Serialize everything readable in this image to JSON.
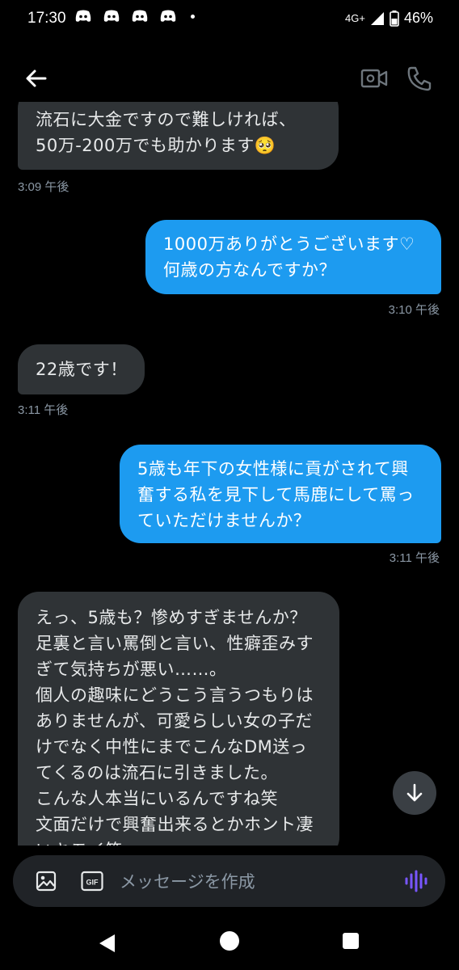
{
  "status_bar": {
    "time": "17:30",
    "network": "4G+",
    "battery": "46%",
    "notification_icons": [
      "discord-icon",
      "discord-icon",
      "discord-icon",
      "discord-icon"
    ]
  },
  "header": {
    "back_icon": "back-arrow-icon",
    "actions": [
      "video-call-icon",
      "phone-call-icon"
    ]
  },
  "messages": [
    {
      "side": "received",
      "lines": [
        "流石に大金ですので難しければ、",
        "50万-200万でも助かります🥺"
      ],
      "time": "3:09 午後"
    },
    {
      "side": "sent",
      "lines": [
        "1000万ありがとうございます♡",
        "何歳の方なんですか？"
      ],
      "time": "3:10 午後"
    },
    {
      "side": "received",
      "lines": [
        "22歳です！"
      ],
      "time": "3:11 午後"
    },
    {
      "side": "sent",
      "lines": [
        "5歳も年下の女性様に貢がされて興",
        "奮する私を見下して馬鹿にして罵っ",
        "ていただけませんか？"
      ],
      "time": "3:11 午後"
    },
    {
      "side": "received",
      "lines": [
        "えっ、5歳も？惨めすぎませんか？",
        "足裏と言い罵倒と言い、性癖歪みす",
        "ぎて気持ちが悪い……。",
        "個人の趣味にどうこう言うつもりは",
        "ありませんが、可愛らしい女の子だ",
        "けでなく中性にまでこんなDM送っ",
        "てくるのは流石に引きました。",
        "こんな人本当にいるんですね笑",
        "文面だけで興奮出来るとかホント凄",
        "いキモイ笑"
      ]
    }
  ],
  "composer": {
    "placeholder": "メッセージを作成",
    "gif_label": "GIF"
  },
  "colors": {
    "background": "#000000",
    "sent_bubble": "#1d9bf0",
    "received_bubble": "#2f3336",
    "timestamp": "#8b98a5",
    "voice_accent": "#7856ff"
  }
}
